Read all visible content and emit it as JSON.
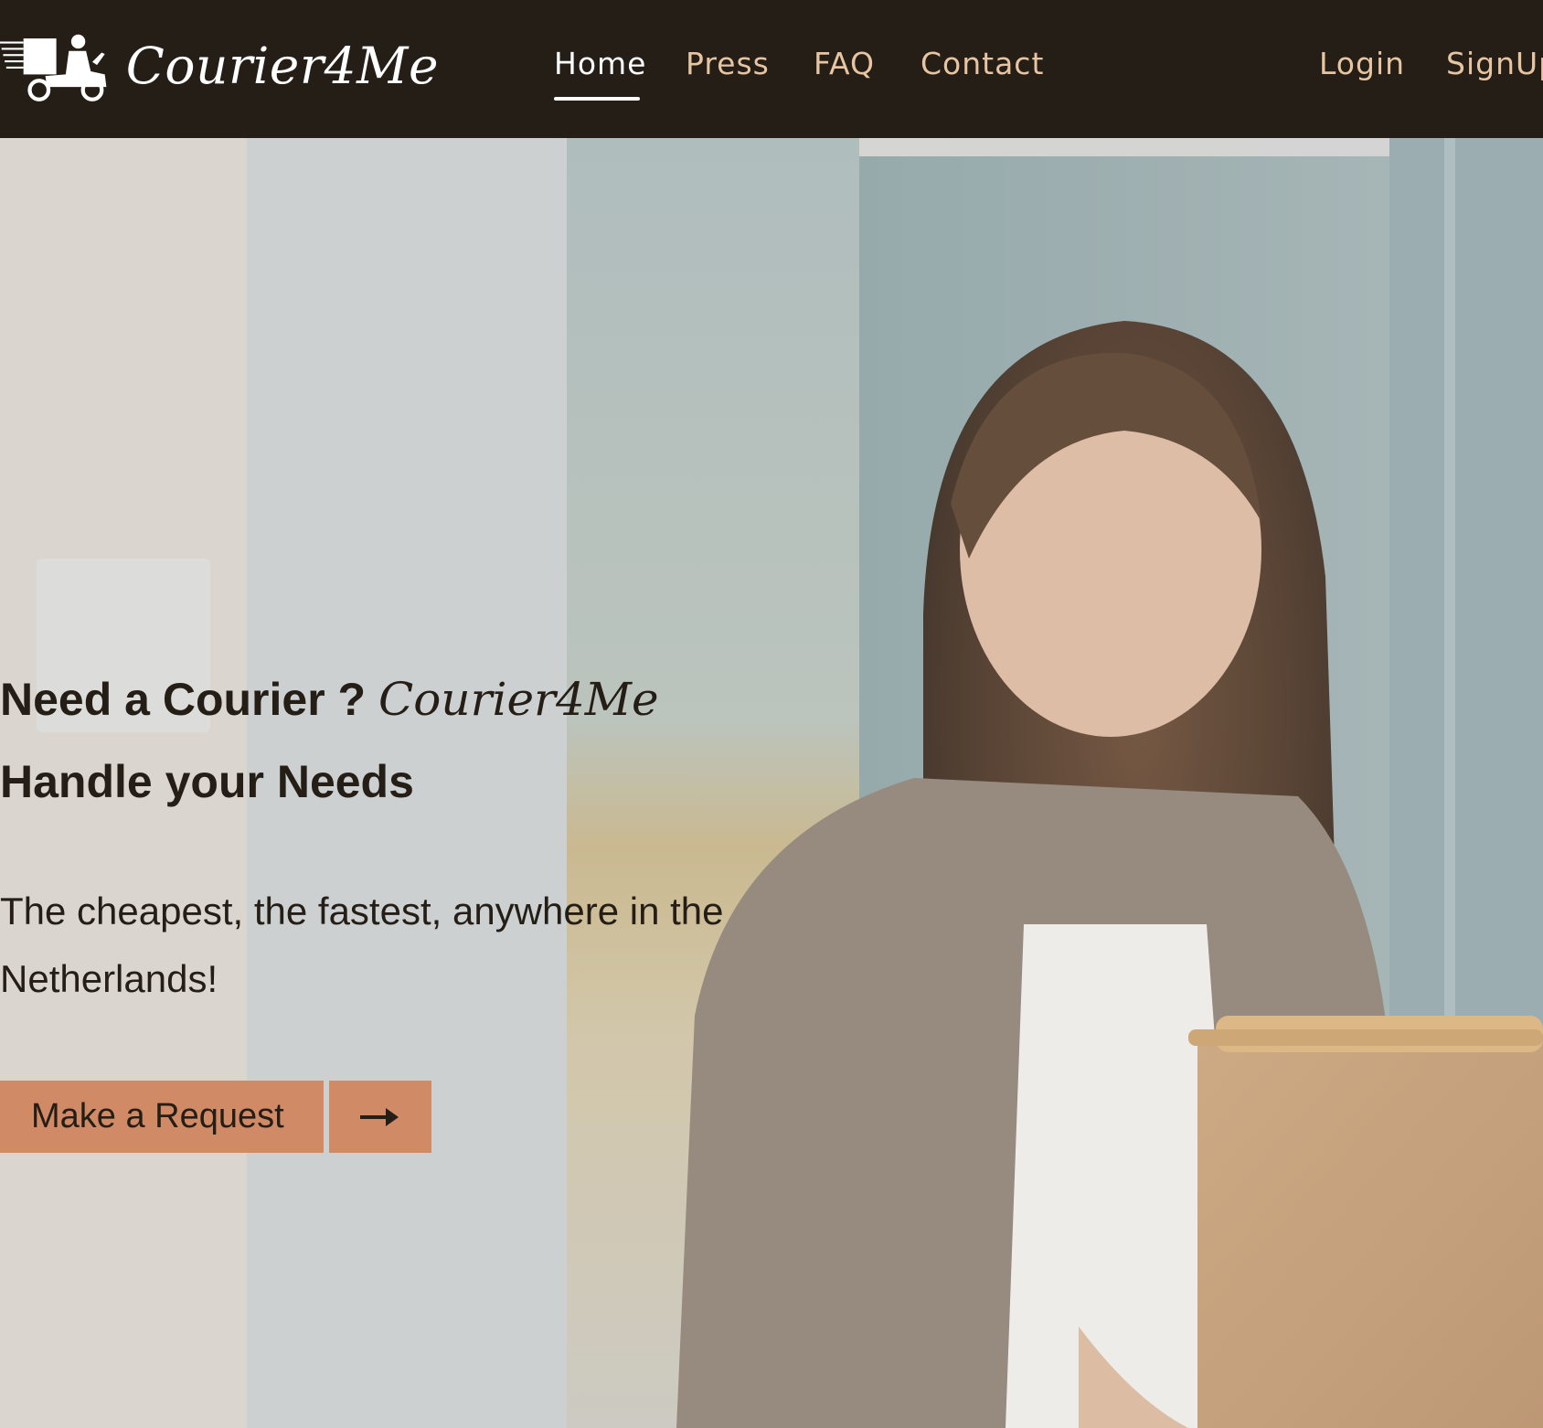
{
  "nav": {
    "brand": "Courier4Me",
    "links": [
      {
        "label": "Home",
        "active": true
      },
      {
        "label": "Press",
        "active": false
      },
      {
        "label": "FAQ",
        "active": false
      },
      {
        "label": "Contact",
        "active": false
      }
    ],
    "auth": {
      "login": "Login",
      "signup": "SignUp"
    }
  },
  "hero": {
    "title_part1": "Need a Courier ?",
    "title_brand": "Courier4Me",
    "title_part2": "Handle your Needs",
    "subtitle": "The cheapest, the fastest, anywhere in the Netherlands!",
    "cta_label": "Make a Request",
    "cta_icon": "arrow-right-icon"
  },
  "colors": {
    "navbar_bg": "#241e16",
    "nav_link": "#e8c5a2",
    "nav_active": "#ffffff",
    "cta_bg": "#d08a65",
    "text_dark": "#241e16"
  }
}
